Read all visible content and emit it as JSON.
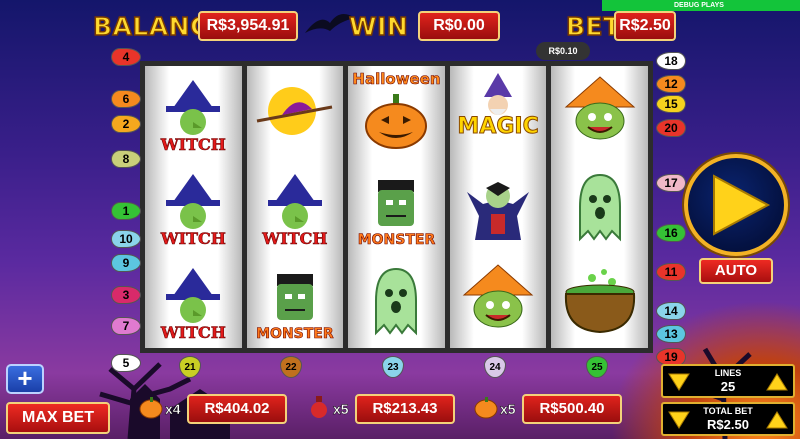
{
  "debug_label": "DEBUG PLAYS",
  "header": {
    "balance_label": "BALANCE",
    "balance_value": "R$3,954.91",
    "win_label": "WIN",
    "win_value": "R$0.00",
    "bet_label": "BET",
    "bet_value": "R$2.50",
    "bet_small": "R$0.10"
  },
  "reels": [
    {
      "symbols": [
        {
          "icon": "witch-icon",
          "word": "WITCH"
        },
        {
          "icon": "witch-icon",
          "word": "WITCH"
        },
        {
          "icon": "witch-icon",
          "word": "WITCH"
        }
      ]
    },
    {
      "symbols": [
        {
          "icon": "moon-witch-icon",
          "word": ""
        },
        {
          "icon": "witch-icon",
          "word": "WITCH"
        },
        {
          "icon": "monster-icon",
          "word": "MONSTER"
        }
      ]
    },
    {
      "symbols": [
        {
          "icon": "pumpkin-icon",
          "word": "Halloween"
        },
        {
          "icon": "monster-icon",
          "word": "MONSTER"
        },
        {
          "icon": "ghost-icon",
          "word": ""
        }
      ]
    },
    {
      "symbols": [
        {
          "icon": "wizard-icon",
          "word": "MAGIC"
        },
        {
          "icon": "vampire-icon",
          "word": ""
        },
        {
          "icon": "scarecrow-icon",
          "word": ""
        }
      ]
    },
    {
      "symbols": [
        {
          "icon": "scarecrow-icon",
          "word": ""
        },
        {
          "icon": "ghost-icon",
          "word": ""
        },
        {
          "icon": "cauldron-icon",
          "word": ""
        }
      ]
    }
  ],
  "line_markers": {
    "left": [
      "4",
      "6",
      "2",
      "8",
      "1",
      "10",
      "9",
      "3",
      "7",
      "5"
    ],
    "right": [
      "18",
      "12",
      "15",
      "20",
      "17",
      "16",
      "11",
      "14",
      "13",
      "19"
    ],
    "bottom": [
      "21",
      "22",
      "23",
      "24",
      "25"
    ]
  },
  "colors": {
    "left": [
      "#e8342a",
      "#f58a1e",
      "#f5a81e",
      "#c9cf7a",
      "#35c235",
      "#8ad4ea",
      "#5cc6e0",
      "#d92a6a",
      "#e07ad0",
      "#ffffff"
    ],
    "right": [
      "#ffffff",
      "#f58a1e",
      "#f5d21e",
      "#e8342a",
      "#f0b8c8",
      "#35c235",
      "#e8342a",
      "#8ad4ea",
      "#5cc6e0",
      "#e8342a"
    ],
    "bottom": [
      "#c9cf24",
      "#c0701e",
      "#8ad4ea",
      "#d9c9e8",
      "#35c235"
    ]
  },
  "controls": {
    "play_icon": "play-icon",
    "auto_label": "AUTO",
    "plus_label": "+",
    "maxbet_label": "MAX BET",
    "lines_label": "LINES",
    "lines_value": "25",
    "totalbet_label": "TOTAL BET",
    "totalbet_value": "R$2.50"
  },
  "prizes": [
    {
      "icon": "pumpkin-icon",
      "mult": "x4",
      "value": "R$404.02"
    },
    {
      "icon": "potion-icon",
      "mult": "x5",
      "value": "R$213.43"
    },
    {
      "icon": "pumpkin-icon",
      "mult": "x5",
      "value": "R$500.40"
    }
  ]
}
